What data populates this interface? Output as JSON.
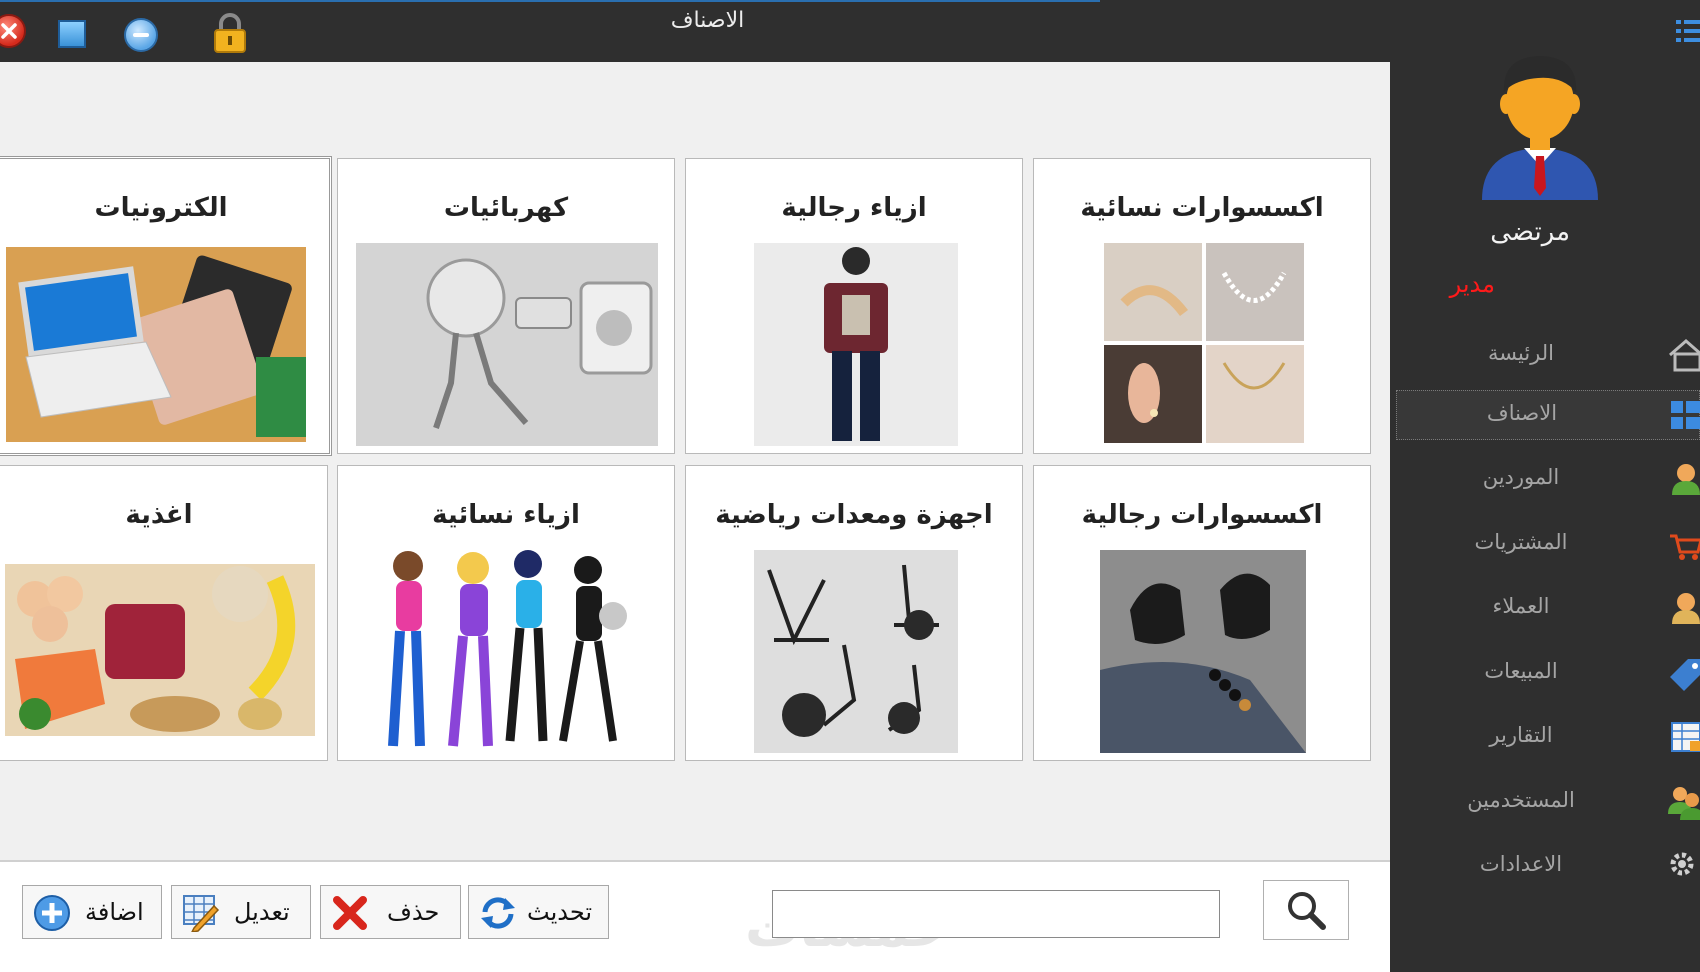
{
  "window": {
    "title": "الاصناف"
  },
  "categories": [
    {
      "label": "اكسسوارات نسائية"
    },
    {
      "label": "ازياء رجالية"
    },
    {
      "label": "كهربائيات"
    },
    {
      "label": "الكترونيات"
    },
    {
      "label": "اكسسوارات رجالية"
    },
    {
      "label": "اجهزة ومعدات رياضية"
    },
    {
      "label": "ازياء نسائية"
    },
    {
      "label": "اغذية"
    }
  ],
  "actions": {
    "add": "اضافة",
    "edit": "تعديل",
    "delete": "حذف",
    "refresh": "تحديث"
  },
  "search": {
    "value": ""
  },
  "watermark": "خمسات",
  "user": {
    "name": "مرتضى",
    "role": "مدير"
  },
  "sidebar": {
    "items": [
      {
        "label": "الرئيسة",
        "icon": "home-icon"
      },
      {
        "label": "الاصناف",
        "icon": "grid-icon"
      },
      {
        "label": "الموردين",
        "icon": "user-icon"
      },
      {
        "label": "المشتريات",
        "icon": "cart-icon"
      },
      {
        "label": "العملاء",
        "icon": "user-icon"
      },
      {
        "label": "المبيعات",
        "icon": "tag-icon"
      },
      {
        "label": "التقارير",
        "icon": "report-icon"
      },
      {
        "label": "المستخدمين",
        "icon": "users-icon"
      },
      {
        "label": "الاعدادات",
        "icon": "gear-icon"
      }
    ]
  },
  "colors": {
    "background": "#2f2f2f",
    "content": "#f0f0f0",
    "role": "#ff1a1a",
    "nav_text": "#a5a5a5"
  }
}
